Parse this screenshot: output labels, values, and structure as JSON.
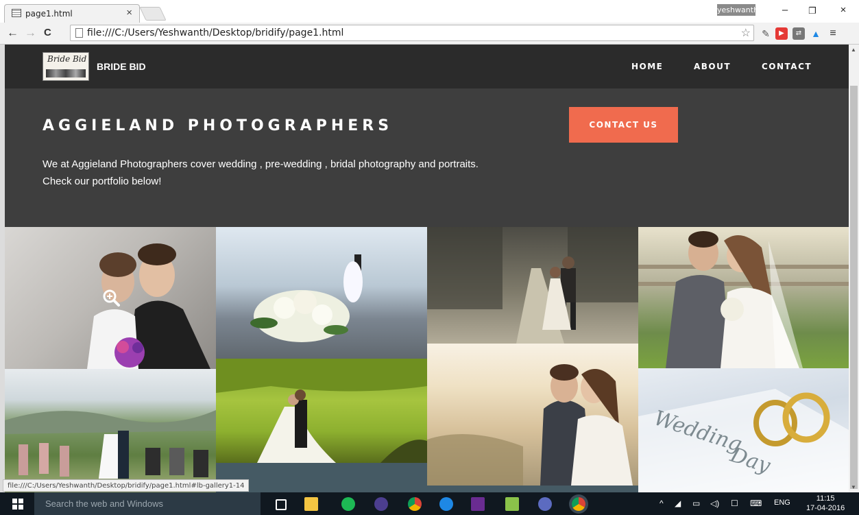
{
  "browser": {
    "tab_title": "page1.html",
    "tab_close": "×",
    "profile_name": "yeshwanth",
    "address": "file:///C:/Users/Yeshwanth/Desktop/bridify/page1.html",
    "status_url": "file:///C:/Users/Yeshwanth/Desktop/bridify/page1.html#lb-gallery1-14",
    "window_controls": {
      "minimize": "–",
      "restore": "❐",
      "close": "×"
    },
    "nav": {
      "back": "←",
      "forward": "→",
      "reload": "C"
    }
  },
  "site": {
    "logo_text": "Bride Bid",
    "brand": "BRIDE BID",
    "menu": [
      {
        "label": "HOME"
      },
      {
        "label": "ABOUT"
      },
      {
        "label": "CONTACT"
      }
    ]
  },
  "hero": {
    "title": "AGGIELAND PHOTOGRAPHERS",
    "description_line1": "We at Aggieland Photographers cover wedding , pre-wedding , bridal photography and portraits.",
    "description_line2": "Check our portfolio below!",
    "cta_label": "CONTACT US",
    "cta_color": "#f06b4e"
  },
  "taskbar": {
    "search_placeholder": "Search the web and Windows",
    "language": "ENG",
    "time": "11:15",
    "date": "17-04-2016"
  }
}
